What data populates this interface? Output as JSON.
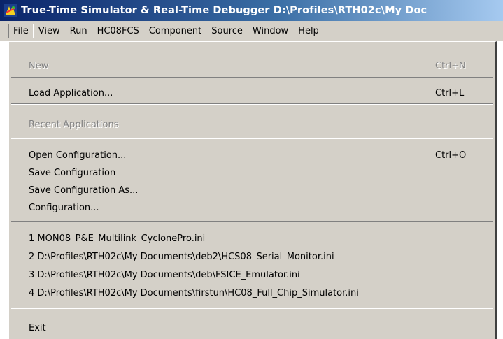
{
  "window": {
    "title": "True-Time Simulator & Real-Time Debugger   D:\\Profiles\\RTH02c\\My Doc",
    "icon": "simulator-app-icon"
  },
  "menubar": {
    "items": [
      "File",
      "View",
      "Run",
      "HC08FCS",
      "Component",
      "Source",
      "Window",
      "Help"
    ],
    "active": "File"
  },
  "file_menu": {
    "new": {
      "label": "New",
      "shortcut": "Ctrl+N",
      "enabled": false
    },
    "load_application": {
      "label": "Load Application...",
      "shortcut": "Ctrl+L",
      "enabled": true
    },
    "recent_applications": {
      "label": "Recent Applications",
      "enabled": false
    },
    "open_configuration": {
      "label": "Open Configuration...",
      "shortcut": "Ctrl+O",
      "enabled": true
    },
    "save_configuration": {
      "label": "Save Configuration",
      "enabled": true
    },
    "save_configuration_as": {
      "label": "Save Configuration As...",
      "enabled": true
    },
    "configuration": {
      "label": "Configuration...",
      "enabled": true
    },
    "recent_configs": [
      "1 MON08_P&E_Multilink_CyclonePro.ini",
      "2 D:\\Profiles\\RTH02c\\My Documents\\deb2\\HCS08_Serial_Monitor.ini",
      "3 D:\\Profiles\\RTH02c\\My Documents\\deb\\FSICE_Emulator.ini",
      "4 D:\\Profiles\\RTH02c\\My Documents\\firstun\\HC08_Full_Chip_Simulator.ini"
    ],
    "exit": {
      "label": "Exit",
      "enabled": true
    }
  }
}
